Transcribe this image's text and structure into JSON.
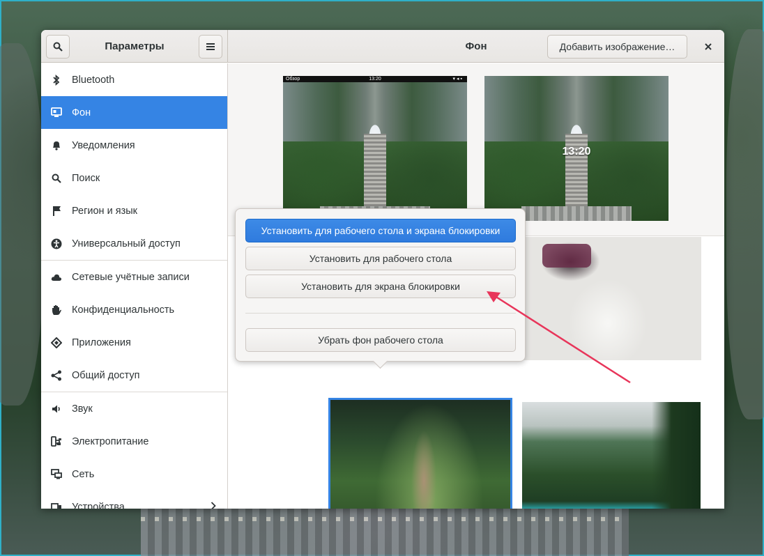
{
  "window": {
    "sidebar_title": "Параметры",
    "panel_title": "Фон",
    "add_image_label": "Добавить изображение…"
  },
  "sidebar": {
    "items": [
      {
        "label": "Bluetooth",
        "icon": "bluetooth-icon"
      },
      {
        "label": "Фон",
        "icon": "background-icon",
        "active": true
      },
      {
        "label": "Уведомления",
        "icon": "bell-icon"
      },
      {
        "label": "Поиск",
        "icon": "search-icon"
      },
      {
        "label": "Регион и язык",
        "icon": "flag-icon"
      },
      {
        "label": "Универсальный доступ",
        "icon": "accessibility-icon"
      },
      {
        "label": "Сетевые учётные записи",
        "icon": "cloud-icon"
      },
      {
        "label": "Конфиденциальность",
        "icon": "hand-icon"
      },
      {
        "label": "Приложения",
        "icon": "apps-icon"
      },
      {
        "label": "Общий доступ",
        "icon": "share-icon"
      },
      {
        "label": "Звук",
        "icon": "speaker-icon"
      },
      {
        "label": "Электропитание",
        "icon": "power-icon"
      },
      {
        "label": "Сеть",
        "icon": "network-icon"
      },
      {
        "label": "Устройства",
        "icon": "devices-icon"
      }
    ]
  },
  "preview": {
    "lock_bar_left": "Обзор",
    "lock_bar_time": "13:20",
    "lock_clock": "13:20"
  },
  "popover": {
    "both_label": "Установить для рабочего стола и экрана блокировки",
    "desktop_label": "Установить для рабочего стола",
    "lock_label": "Установить для экрана блокировки",
    "remove_label": "Убрать фон рабочего стола"
  },
  "colors": {
    "accent": "#3584e4",
    "annotation_arrow": "#e8355a"
  }
}
